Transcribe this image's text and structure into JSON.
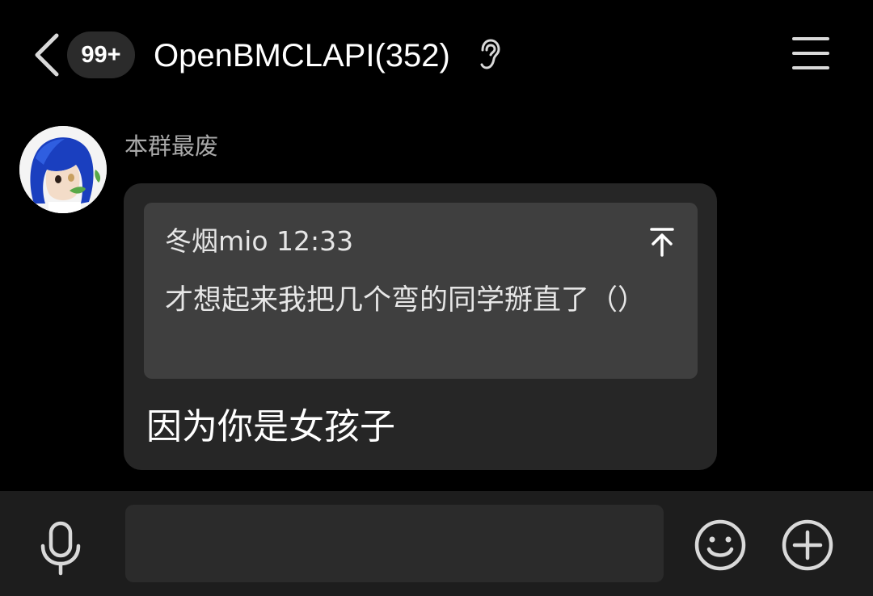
{
  "header": {
    "back_icon": "chevron-left-icon",
    "unread_badge": "99+",
    "title": "OpenBMCLAPI(352)",
    "ear_icon": "ear-icon",
    "menu_icon": "hamburger-menu-icon"
  },
  "messages": [
    {
      "sender": "本群最废",
      "avatar_icon": "anime-avatar",
      "quote": {
        "header": "冬烟mio 12:33",
        "text": "才想起来我把几个弯的同学掰直了（）",
        "jump_icon": "jump-to-original-icon"
      },
      "text": "因为你是女孩子"
    }
  ],
  "input_bar": {
    "mic_icon": "microphone-icon",
    "input_value": "",
    "input_placeholder": "",
    "emoji_icon": "emoji-icon",
    "plus_icon": "plus-circle-icon"
  },
  "colors": {
    "background": "#000000",
    "bubble": "#262626",
    "quote": "#3f3f3f",
    "input_bar": "#1d1d1d",
    "icon": "#d9d9d9",
    "sender_name": "#a9a9a9"
  }
}
